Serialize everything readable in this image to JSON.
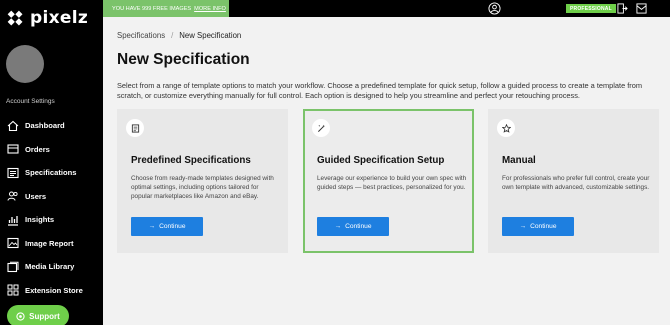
{
  "brand": {
    "name": "pixelz",
    "accent": "#6fcf4a",
    "button_blue": "#1e7fe0"
  },
  "sidebar": {
    "account_settings": "Account Settings",
    "items": [
      {
        "label": "Dashboard",
        "icon": "dashboard-icon"
      },
      {
        "label": "Orders",
        "icon": "orders-icon"
      },
      {
        "label": "Specifications",
        "icon": "specifications-icon"
      },
      {
        "label": "Users",
        "icon": "users-icon"
      },
      {
        "label": "Insights",
        "icon": "insights-icon"
      },
      {
        "label": "Image Report",
        "icon": "image-report-icon"
      },
      {
        "label": "Media Library",
        "icon": "media-library-icon"
      },
      {
        "label": "Extension Store",
        "icon": "extension-store-icon"
      }
    ],
    "support_label": "Support"
  },
  "topbar": {
    "promo_text": "YOU HAVE 999 FREE IMAGES",
    "promo_link": "MORE INFO",
    "plan_badge": "PROFESSIONAL"
  },
  "breadcrumb": {
    "parent": "Specifications",
    "separator": "/",
    "current": "New Specification"
  },
  "page": {
    "title": "New Specification",
    "intro": "Select from a range of template options to match your workflow. Choose a predefined template for quick setup, follow a guided process to create a template from scratch, or customize everything manually for full control. Each option is designed to help you streamline and perfect your retouching process."
  },
  "cards": [
    {
      "title": "Predefined Specifications",
      "icon": "template-icon",
      "description": "Choose from ready-made templates designed with optimal settings, including options tailored for popular marketplaces like Amazon and eBay.",
      "button": "Continue",
      "selected": false
    },
    {
      "title": "Guided Specification Setup",
      "icon": "magic-wand-icon",
      "description": "Leverage our experience to build your own spec with guided steps — best practices, personalized for you.",
      "button": "Continue",
      "selected": true
    },
    {
      "title": "Manual",
      "icon": "star-icon",
      "description": "For professionals who prefer full control, create your own template with advanced, customizable settings.",
      "button": "Continue",
      "selected": false
    }
  ]
}
